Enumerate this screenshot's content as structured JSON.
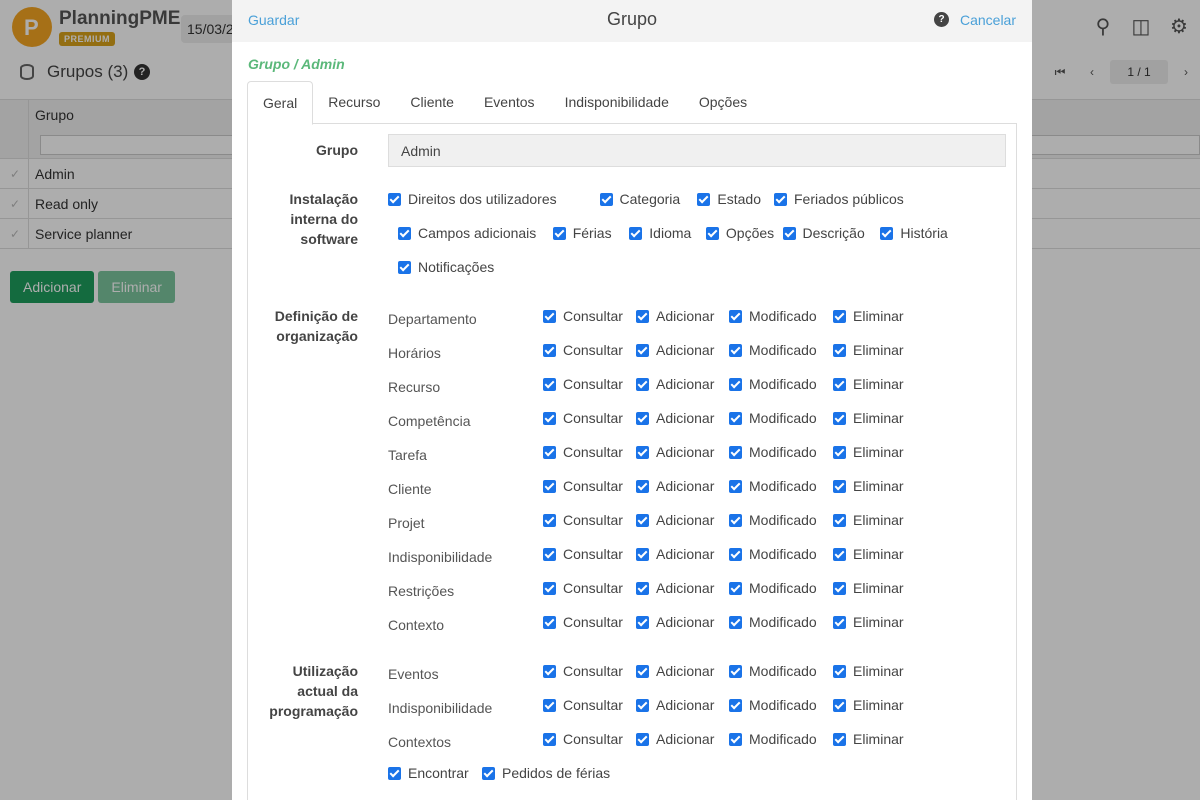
{
  "app": {
    "logo_name": "PlanningPME",
    "logo_badge": "PREMIUM",
    "date": "15/03/2",
    "page_title": "Grupos (3)",
    "pager_label": "1 / 1"
  },
  "grid": {
    "column": "Grupo",
    "rows": [
      "Admin",
      "Read only",
      "Service planner"
    ]
  },
  "bg_buttons": {
    "add": "Adicionar",
    "delete": "Eliminar"
  },
  "modal": {
    "save": "Guardar",
    "title": "Grupo",
    "cancel": "Cancelar",
    "breadcrumb": "Grupo / Admin",
    "tabs": [
      "Geral",
      "Recurso",
      "Cliente",
      "Eventos",
      "Indisponibilidade",
      "Opções"
    ],
    "group_label": "Grupo",
    "group_value": "Admin",
    "install_label_1": "Instalação",
    "install_label_2": "interna do",
    "install_label_3": "software",
    "install_options": [
      "Direitos dos utilizadores",
      "Categoria",
      "Estado",
      "Feriados públicos",
      "Campos adicionais",
      "Férias",
      "Idioma",
      "Opções",
      "Descrição",
      "História",
      "Notificações"
    ],
    "org_label_1": "Definição de",
    "org_label_2": "organização",
    "org_rows": [
      "Departamento",
      "Horários",
      "Recurso",
      "Competência",
      "Tarefa",
      "Cliente",
      "Projet",
      "Indisponibilidade",
      "Restrições",
      "Contexto"
    ],
    "perm_labels": [
      "Consultar",
      "Adicionar",
      "Modificado",
      "Eliminar"
    ],
    "usage_label_1": "Utilização",
    "usage_label_2": "actual da",
    "usage_label_3": "programação",
    "usage_rows": [
      "Eventos",
      "Indisponibilidade",
      "Contextos"
    ],
    "usage_extra": [
      "Encontrar",
      "Pedidos de férias"
    ]
  }
}
